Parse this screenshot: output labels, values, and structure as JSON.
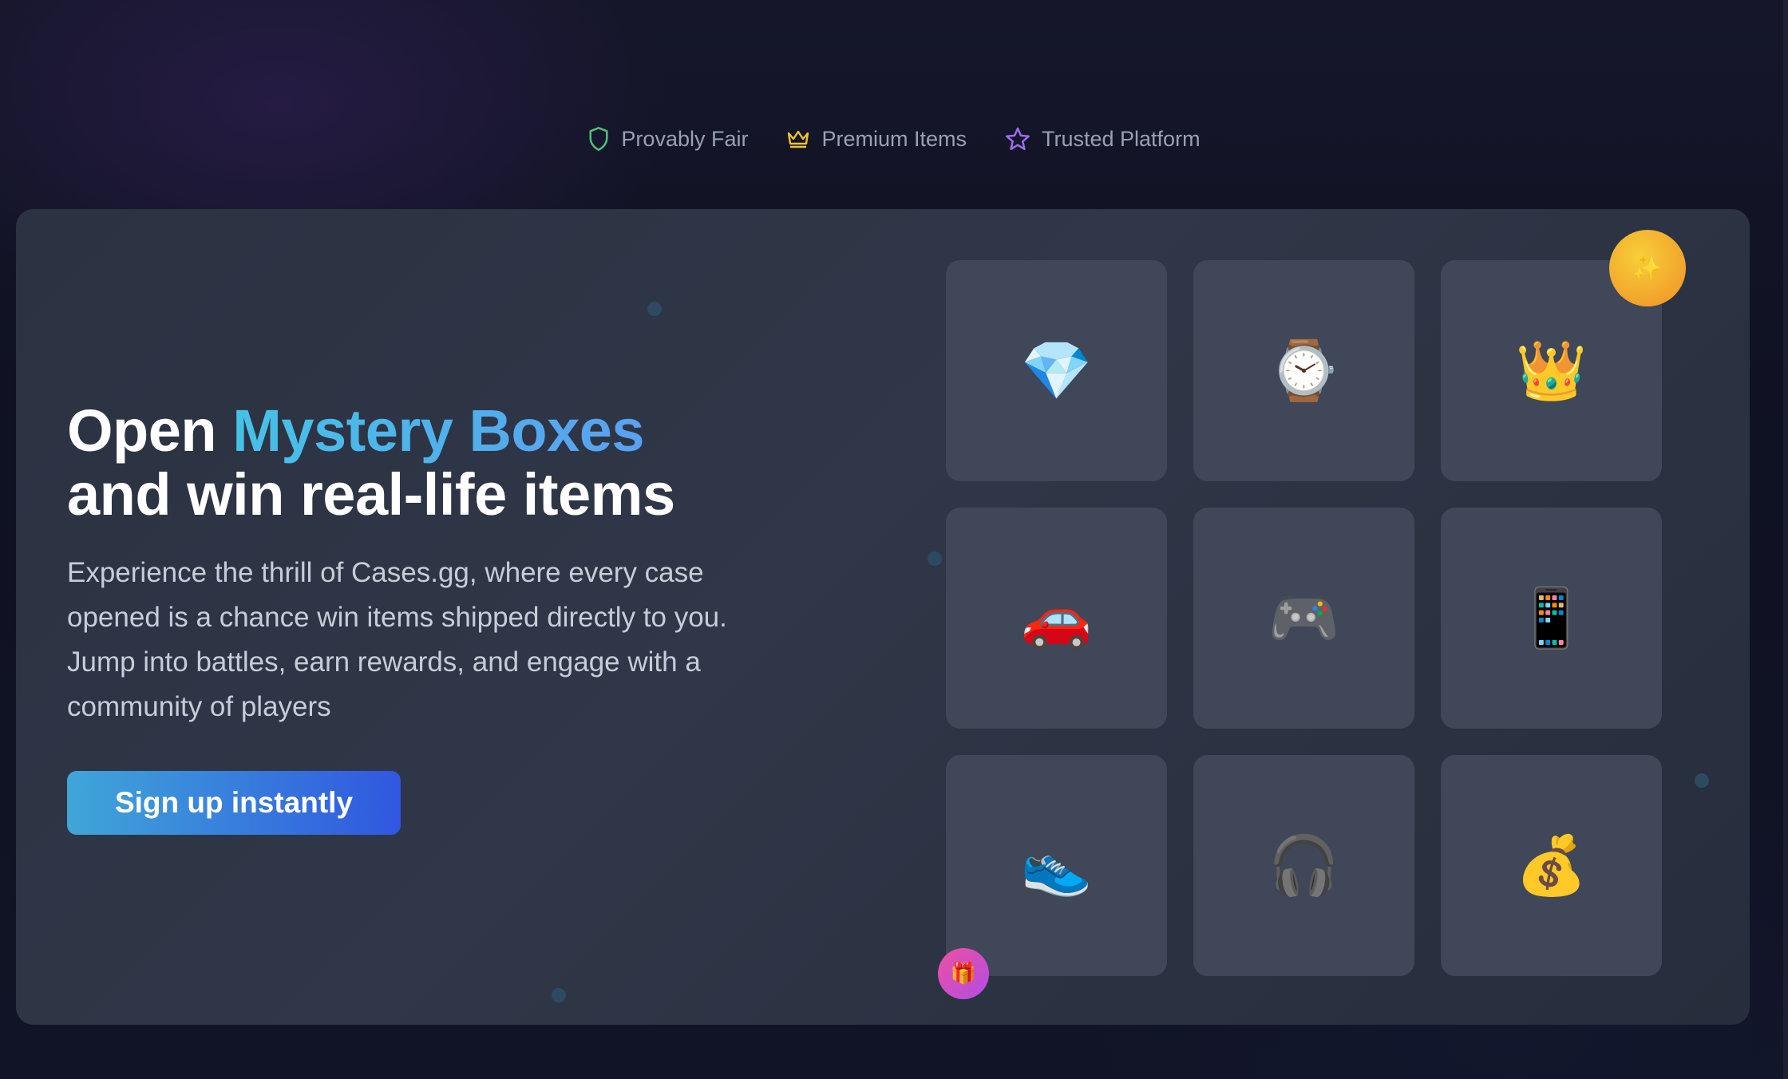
{
  "trust_badges": [
    {
      "label": "Provably Fair",
      "icon": "shield-icon",
      "color": "#4fbf7a"
    },
    {
      "label": "Premium Items",
      "icon": "crown-icon",
      "color": "#f1c232"
    },
    {
      "label": "Trusted Platform",
      "icon": "star-icon",
      "color": "#a06cf0"
    }
  ],
  "hero": {
    "title_prefix": "Open ",
    "title_highlight": "Mystery Boxes",
    "title_line2": "and win real-life items",
    "description": "Experience the thrill of Cases.gg, where every case opened is a chance win items shipped directly to you. Jump into battles, earn rewards, and engage with a community of players",
    "cta_label": "Sign up instantly",
    "accent_gradient": [
      "#40a6d8",
      "#3057e0"
    ]
  },
  "items": [
    {
      "name": "diamond",
      "glyph": "💎"
    },
    {
      "name": "watch",
      "glyph": "⌚"
    },
    {
      "name": "crown",
      "glyph": "👑"
    },
    {
      "name": "car",
      "glyph": "🚗"
    },
    {
      "name": "game-controller",
      "glyph": "🎮"
    },
    {
      "name": "phone",
      "glyph": "📱"
    },
    {
      "name": "sneaker",
      "glyph": "👟"
    },
    {
      "name": "headphones",
      "glyph": "🎧"
    },
    {
      "name": "money-bag",
      "glyph": "💰"
    }
  ],
  "floating_badges": {
    "sparkle": "✨",
    "gift": "🎁"
  }
}
